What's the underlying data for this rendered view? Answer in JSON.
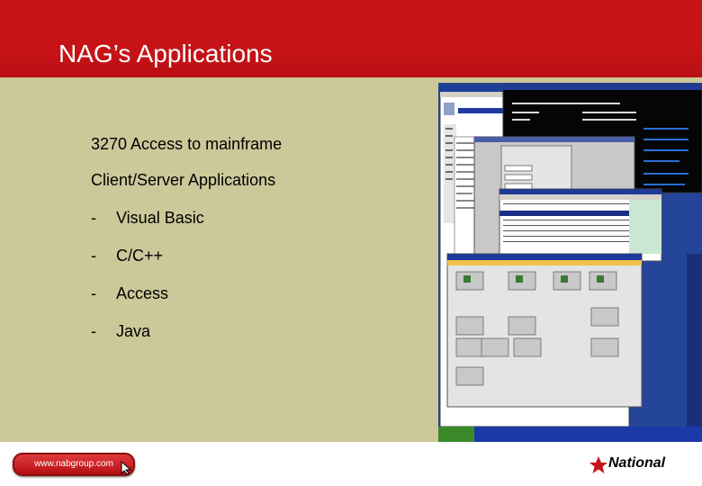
{
  "header": {
    "title": "NAG’s Applications"
  },
  "bullets": [
    {
      "text": "3270 Access to mainframe",
      "dash": ""
    },
    {
      "text": "Client/Server Applications",
      "dash": ""
    },
    {
      "text": "Visual Basic",
      "dash": "-"
    },
    {
      "text": "C/C++",
      "dash": "-"
    },
    {
      "text": "Access",
      "dash": "-"
    },
    {
      "text": "Java",
      "dash": "-"
    }
  ],
  "footer": {
    "url": "www.nabgroup.com",
    "logo_text": "National"
  },
  "colors": {
    "header_red": "#c71418",
    "content_bg": "#ccc89a"
  }
}
